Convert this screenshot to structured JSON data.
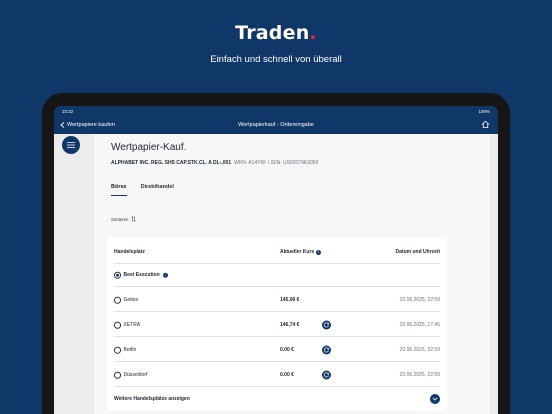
{
  "promo": {
    "title": "Traden",
    "title_dot": ".",
    "subtitle": "Einfach und schnell von überall"
  },
  "statusbar": {
    "time": "10:22",
    "battery": "100%"
  },
  "navbar": {
    "back_label": "Wertpapiere kaufen",
    "title": "Wertpapierkauf - Ordereingabe"
  },
  "page": {
    "title": "Wertpapier-Kauf",
    "title_dot": ".",
    "security_name": "ALPHABET INC. REG. SHS CAP.STK.CL. A DL-,001",
    "security_ids": "WKN: A14Y6F / ISIN: US02079K3059"
  },
  "tabs": [
    {
      "label": "Börse",
      "active": true
    },
    {
      "label": "Direkthandel",
      "active": false
    }
  ],
  "sort": {
    "label": "Sortieren"
  },
  "table": {
    "headers": {
      "venue": "Handelsplatz",
      "price": "Aktueller Kurs",
      "date": "Datum und Uhrzeit"
    },
    "rows": [
      {
        "venue": "Best Execution",
        "price": "",
        "date": "",
        "selected": true,
        "info": true
      },
      {
        "venue": "Gettex",
        "price": "145,06 €",
        "date": "20.06.2025, 22:59",
        "selected": false,
        "refresh": false
      },
      {
        "venue": "XETRA",
        "price": "146,74 €",
        "date": "20.06.2025, 17:45",
        "selected": false,
        "refresh": true
      },
      {
        "venue": "Berlin",
        "price": "0.00 €",
        "date": "20.06.2025, 22:59",
        "selected": false,
        "refresh": true
      },
      {
        "venue": "Düsseldorf",
        "price": "0.00 €",
        "date": "20.06.2025, 22:00",
        "selected": false,
        "refresh": true
      }
    ],
    "more_label": "Weitere Handelsplätze anzeigen"
  },
  "colors": {
    "brand_navy": "#0f3767",
    "accent_red": "#e3243b"
  }
}
